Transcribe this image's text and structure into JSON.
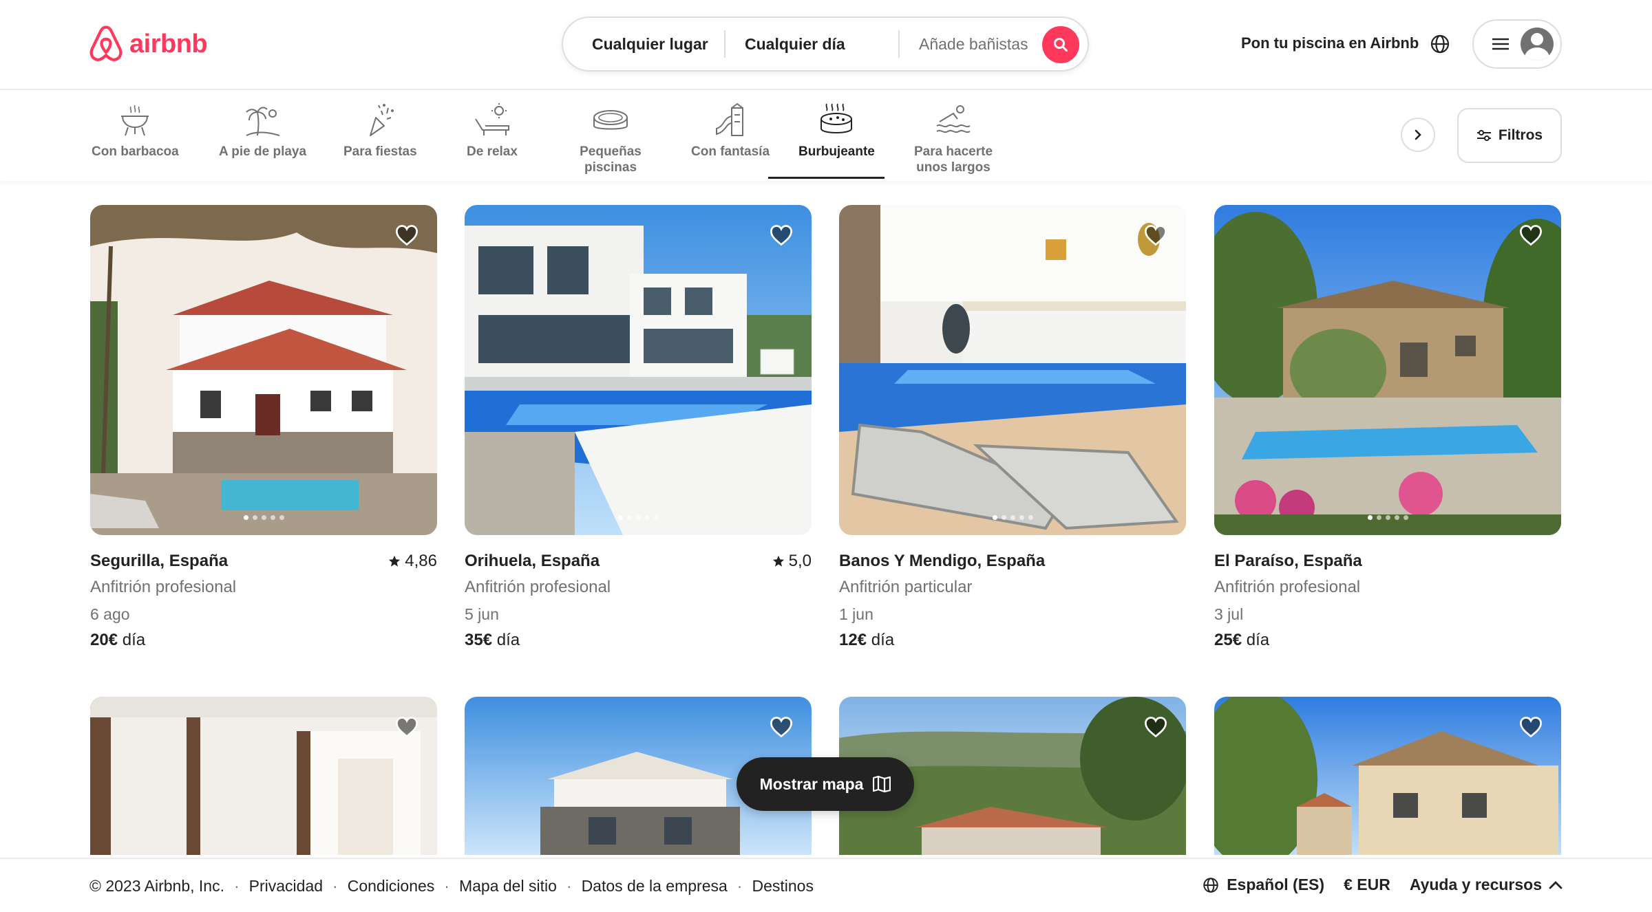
{
  "brand": {
    "name": "airbnb",
    "color": "#FF385C"
  },
  "search": {
    "place": "Cualquier lugar",
    "day": "Cualquier día",
    "guests_placeholder": "Añade bañistas",
    "button_icon": "search-icon"
  },
  "header": {
    "host_link": "Pon tu piscina en Airbnb",
    "globe_icon": "globe-icon",
    "menu_icon": "hamburger-icon"
  },
  "categories": [
    {
      "label": "Con barbacoa",
      "icon": "barbecue-icon"
    },
    {
      "label": "A pie de playa",
      "icon": "beach-palm-icon"
    },
    {
      "label": "Para fiestas",
      "icon": "party-icon"
    },
    {
      "label": "De relax",
      "icon": "lounger-icon"
    },
    {
      "label": "Pequeñas piscinas",
      "icon": "small-pool-icon"
    },
    {
      "label": "Con fantasía",
      "icon": "waterslide-icon"
    },
    {
      "label": "Burbujeante",
      "icon": "hot-tub-icon",
      "active": true
    },
    {
      "label": "Para hacerte unos largos",
      "icon": "swimmer-icon"
    }
  ],
  "filters": {
    "label": "Filtros"
  },
  "listings": [
    {
      "location": "Segurilla, España",
      "rating": "4,86",
      "host": "Anfitrión profesional",
      "date": "6 ago",
      "price": "20€",
      "unit": "día"
    },
    {
      "location": "Orihuela, España",
      "rating": "5,0",
      "host": "Anfitrión profesional",
      "date": "5 jun",
      "price": "35€",
      "unit": "día"
    },
    {
      "location": "Banos Y Mendigo, España",
      "rating": "",
      "host": "Anfitrión particular",
      "date": "1 jun",
      "price": "12€",
      "unit": "día"
    },
    {
      "location": "El Paraíso, España",
      "rating": "",
      "host": "Anfitrión profesional",
      "date": "3 jul",
      "price": "25€",
      "unit": "día"
    }
  ],
  "map_button": {
    "label": "Mostrar mapa"
  },
  "footer": {
    "links": [
      "© 2023 Airbnb, Inc.",
      "Privacidad",
      "Condiciones",
      "Mapa del sitio",
      "Datos de la empresa",
      "Destinos"
    ],
    "language": "Español (ES)",
    "currency": "€  EUR",
    "help": "Ayuda y recursos"
  }
}
